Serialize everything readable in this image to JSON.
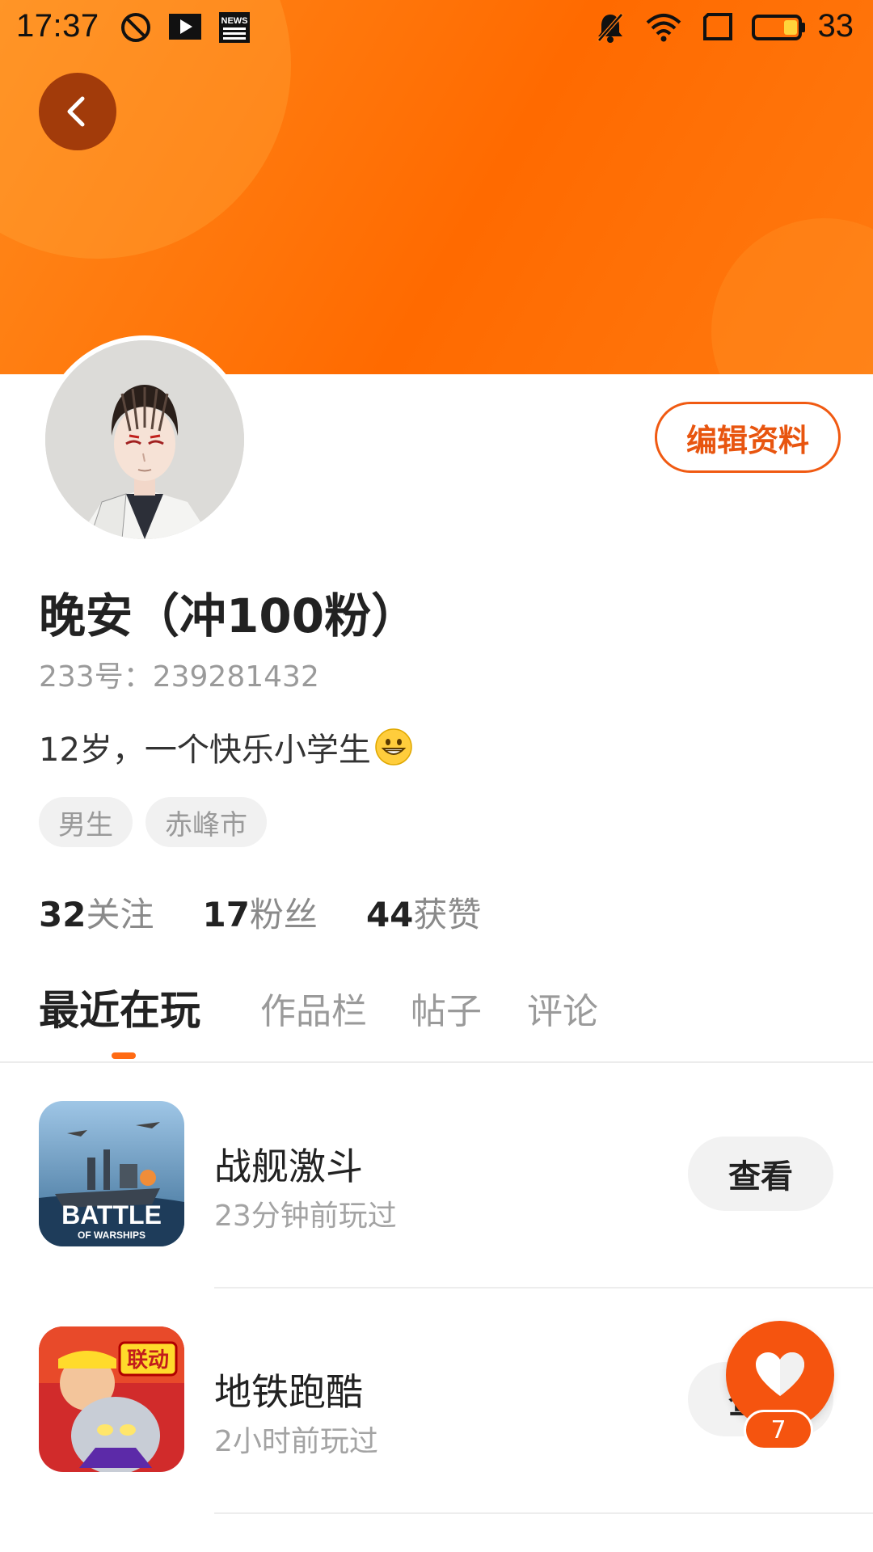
{
  "status_bar": {
    "time": "17:37",
    "battery_level": "33",
    "left_icons": [
      "do-not-disturb-icon",
      "play-icon",
      "news-icon"
    ],
    "right_icons": [
      "bell-muted-icon",
      "wifi-icon",
      "screen-icon",
      "battery-icon"
    ]
  },
  "header": {
    "gradient_colors": [
      "#ff8a1c",
      "#ff6a00"
    ],
    "back_icon": "chevron-left-icon"
  },
  "profile": {
    "nickname": "晚安（冲100粉）",
    "user_id": "233号：239281432",
    "bio": "12岁，一个快乐小学生",
    "bio_emoji": "grinning-face-emoji",
    "edit_button_label": "编辑资料",
    "tags": [
      "男生",
      "赤峰市"
    ],
    "stats": [
      {
        "value": "32",
        "label": "关注"
      },
      {
        "value": "17",
        "label": "粉丝"
      },
      {
        "value": "44",
        "label": "获赞"
      }
    ]
  },
  "tabs": [
    {
      "label": "最近在玩",
      "active": true
    },
    {
      "label": "作品栏",
      "active": false
    },
    {
      "label": "帖子",
      "active": false
    },
    {
      "label": "评论",
      "active": false
    }
  ],
  "games": [
    {
      "title": "战舰激斗",
      "time": "23分钟前玩过",
      "button_label": "查看",
      "icon_text": "BATTLE",
      "icon_subtext": "OF WARSHIPS"
    },
    {
      "title": "地铁跑酷",
      "time": "2小时前玩过",
      "button_label": "查看",
      "icon_text": "联动"
    }
  ],
  "like": {
    "count": "7",
    "icon": "heart-icon"
  },
  "accent_color": "#f5540f"
}
